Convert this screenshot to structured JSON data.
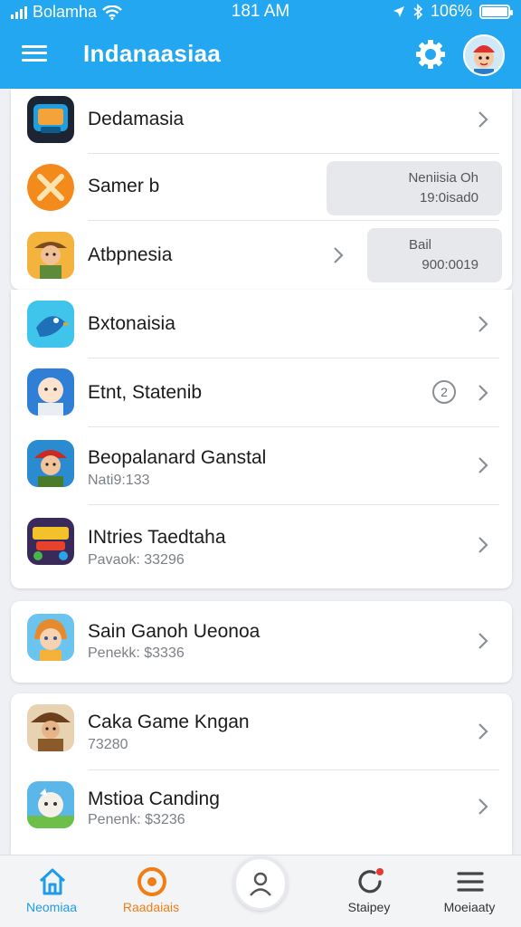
{
  "status_bar": {
    "carrier": "Bolamha",
    "time": "181 AM",
    "battery": "106%",
    "battery_level": 1.0
  },
  "header": {
    "title": "Indanaasiaa"
  },
  "cards": [
    {
      "rows": [
        {
          "title": "Dedamasia",
          "icon": "game-tile-icon"
        },
        {
          "title": "Samer b",
          "icon": "crossed-swords-icon",
          "pill": {
            "line1": "Neniisia Oh",
            "line2": "19:0isad0"
          }
        },
        {
          "title": "Atbpnesia",
          "icon": "explorer-character-icon",
          "pill": {
            "line1": "Bail",
            "line2": "900:0019"
          }
        }
      ]
    },
    {
      "rows": [
        {
          "title": "Bxtonaisia",
          "icon": "bird-character-icon"
        },
        {
          "title": "Etnt, Statenib",
          "icon": "baby-character-icon",
          "badge": "2"
        },
        {
          "title": "Beopalanard Ganstal",
          "subtitle": "Nati9:133",
          "icon": "pirate-character-icon"
        },
        {
          "title": "INtries Taedtaha",
          "subtitle": "Pavaok: 33296",
          "icon": "puzzle-game-icon"
        }
      ]
    },
    {
      "rows": [
        {
          "title": "Sain Ganoh Ueonoa",
          "subtitle": "Penekk: $3336",
          "icon": "girl-character-icon"
        }
      ]
    },
    {
      "rows": [
        {
          "title": "Caka Game Kngan",
          "subtitle": "73280",
          "icon": "cowboy-character-icon"
        },
        {
          "title": "Mstioa Canding",
          "subtitle": "Penenk: $3236",
          "icon": "sheep-character-icon"
        }
      ]
    }
  ],
  "tabs": [
    {
      "label": "Neomiaa",
      "icon": "home-icon",
      "color": "#1e9bea"
    },
    {
      "label": "Raadaiais",
      "icon": "radar-icon",
      "color": "#f07d16"
    },
    {
      "label": "Staipey",
      "icon": "refresh-icon",
      "color": "#333333"
    },
    {
      "label": "Moeiaaty",
      "icon": "menu-lines-icon",
      "color": "#333333"
    }
  ],
  "colors": {
    "primary": "#22a7f0",
    "accent": "#f07d16",
    "background": "#eef0f3"
  }
}
